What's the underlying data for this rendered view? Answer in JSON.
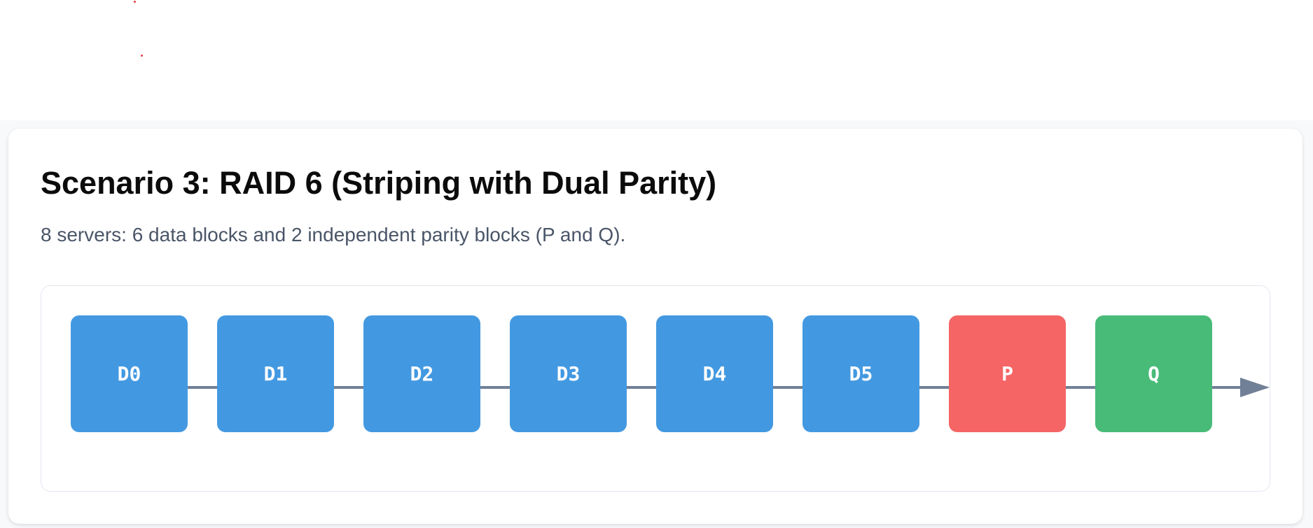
{
  "scenario": {
    "title": "Scenario 3: RAID 6 (Striping with Dual Parity)",
    "description": "8 servers: 6 data blocks and 2 independent parity blocks (P and Q)."
  },
  "blocks": [
    {
      "label": "D0",
      "kind": "data"
    },
    {
      "label": "D1",
      "kind": "data"
    },
    {
      "label": "D2",
      "kind": "data"
    },
    {
      "label": "D3",
      "kind": "data"
    },
    {
      "label": "D4",
      "kind": "data"
    },
    {
      "label": "D5",
      "kind": "data"
    },
    {
      "label": "P",
      "kind": "parity-p"
    },
    {
      "label": "Q",
      "kind": "parity-q"
    }
  ],
  "colors": {
    "data": "#4399e1",
    "parity-p": "#f56565",
    "parity-q": "#48bb78",
    "connector": "#718096",
    "stray_dot": "#e53e3e"
  },
  "icons": {
    "flow_arrow": "arrow-right-icon"
  }
}
